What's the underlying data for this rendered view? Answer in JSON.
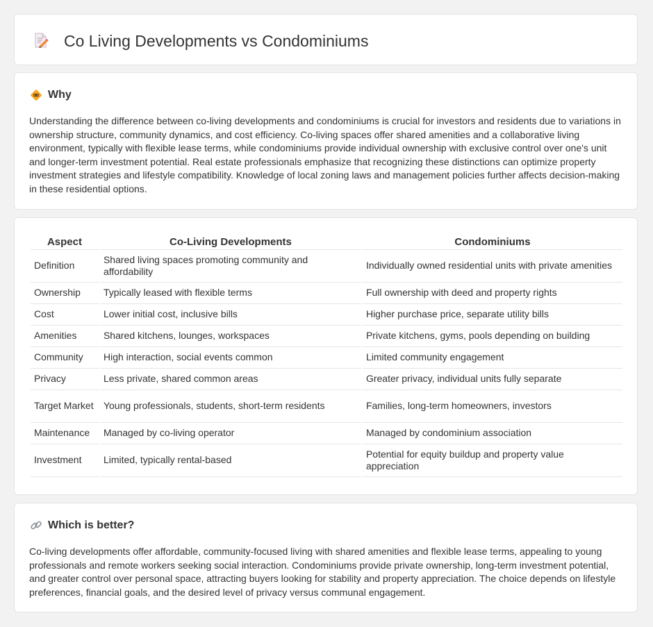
{
  "page": {
    "title": "Co Living Developments vs Condominiums",
    "title_icon": "document-pencil-icon"
  },
  "why": {
    "icon": "diamond-warning-icon",
    "heading": "Why",
    "text": "Understanding the difference between co-living developments and condominiums is crucial for investors and residents due to variations in ownership structure, community dynamics, and cost efficiency. Co-living spaces offer shared amenities and a collaborative living environment, typically with flexible lease terms, while condominiums provide individual ownership with exclusive control over one's unit and longer-term investment potential. Real estate professionals emphasize that recognizing these distinctions can optimize property investment strategies and lifestyle compatibility. Knowledge of local zoning laws and management policies further affects decision-making in these residential options."
  },
  "comparison": {
    "headers": [
      "Aspect",
      "Co-Living Developments",
      "Condominiums"
    ],
    "rows": [
      [
        "Definition",
        "Shared living spaces promoting community and affordability",
        "Individually owned residential units with private amenities"
      ],
      [
        "Ownership",
        "Typically leased with flexible terms",
        "Full ownership with deed and property rights"
      ],
      [
        "Cost",
        "Lower initial cost, inclusive bills",
        "Higher purchase price, separate utility bills"
      ],
      [
        "Amenities",
        "Shared kitchens, lounges, workspaces",
        "Private kitchens, gyms, pools depending on building"
      ],
      [
        "Community",
        "High interaction, social events common",
        "Limited community engagement"
      ],
      [
        "Privacy",
        "Less private, shared common areas",
        "Greater privacy, individual units fully separate"
      ],
      [
        "Target Market",
        "Young professionals, students, short-term residents",
        "Families, long-term homeowners, investors"
      ],
      [
        "Maintenance",
        "Managed by co-living operator",
        "Managed by condominium association"
      ],
      [
        "Investment",
        "Limited, typically rental-based",
        "Potential for equity buildup and property value appreciation"
      ]
    ]
  },
  "better": {
    "icon": "link-icon",
    "heading": "Which is better?",
    "text": "Co-living developments offer affordable, community-focused living with shared amenities and flexible lease terms, appealing to young professionals and remote workers seeking social interaction. Condominiums provide private ownership, long-term investment potential, and greater control over personal space, attracting buyers looking for stability and property appreciation. The choice depends on lifestyle preferences, financial goals, and the desired level of privacy versus communal engagement."
  }
}
